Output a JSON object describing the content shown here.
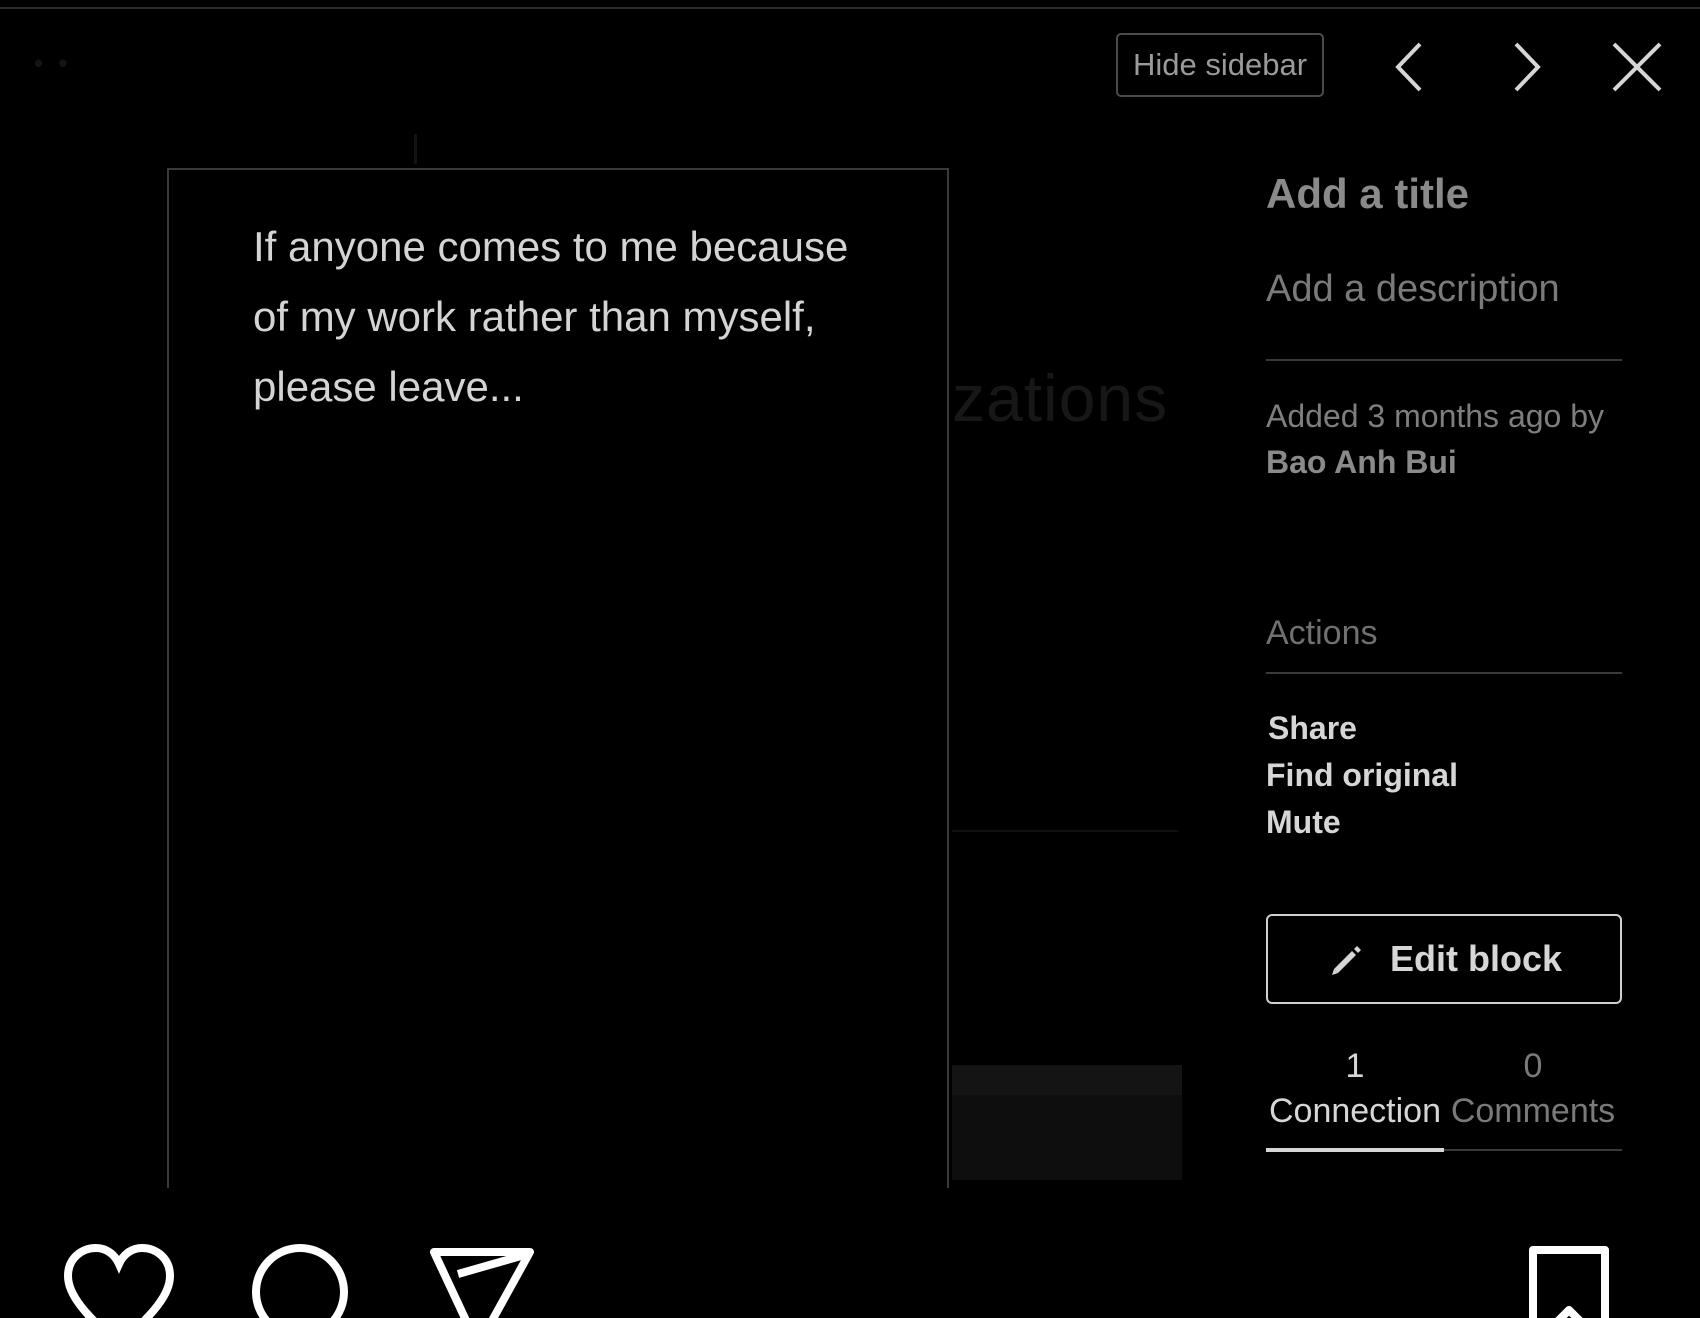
{
  "header": {
    "hide_sidebar_label": "Hide sidebar",
    "prev_icon": "chevron-left-icon",
    "next_icon": "chevron-right-icon",
    "close_icon": "close-icon"
  },
  "background_page": {
    "title_fragment": "zations"
  },
  "block": {
    "text": "If anyone comes to me because of my work rather than myself, please leave..."
  },
  "sidebar": {
    "title_placeholder": "Add a title",
    "description_placeholder": "Add a description",
    "added_text": "Added 3 months ago by",
    "author": "Bao Anh Bui",
    "actions_heading": "Actions",
    "actions": [
      "Share",
      "Find original",
      "Mute"
    ],
    "edit_block_label": "Edit block",
    "edit_icon": "pencil-icon",
    "tabs": [
      {
        "count": "1",
        "label": "Connection",
        "active": true
      },
      {
        "count": "0",
        "label": "Comments",
        "active": false
      }
    ]
  },
  "bottom_bar": {
    "icons": [
      "heart-icon",
      "comment-icon",
      "send-icon",
      "bookmark-icon"
    ]
  },
  "colors": {
    "background": "#000000",
    "text_primary": "#d6d6d6",
    "text_muted": "#7a7a7a"
  }
}
